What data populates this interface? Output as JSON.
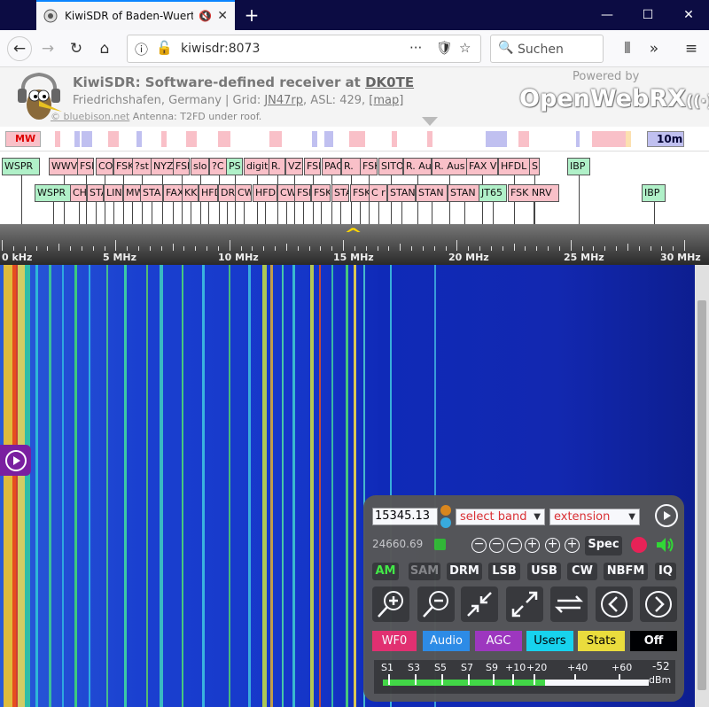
{
  "browser": {
    "tab_title": "KiwiSDR of Baden-Wuerttem",
    "url": "kiwisdr:8073",
    "search_placeholder": "Suchen"
  },
  "header": {
    "title_prefix": "KiwiSDR: Software-defined receiver at ",
    "callsign": "DK0TE",
    "location": "Friedrichshafen, Germany | Grid: ",
    "grid": "JN47rp",
    "asl": ", ASL: 429, ",
    "map": "[map]",
    "copyright": "© bluebison.net",
    "antenna": "Antenna: T2FD under roof.",
    "powered_by": "Powered by",
    "openwebrx": "OpenWebRX"
  },
  "bandbar": {
    "mw_label": "MW",
    "band_label": "10m"
  },
  "labels_row1": [
    {
      "text": "WSPR",
      "green": true
    },
    {
      "text": "WWV",
      "green": false
    },
    {
      "text": "FSK",
      "green": false
    },
    {
      "text": "CO",
      "green": false
    },
    {
      "text": "FSK",
      "green": false
    },
    {
      "text": "?st",
      "green": false
    },
    {
      "text": "NYZ",
      "green": false
    },
    {
      "text": "FSk",
      "green": false
    },
    {
      "text": "slo",
      "green": false
    },
    {
      "text": "?C",
      "green": false
    },
    {
      "text": "PS",
      "green": true
    },
    {
      "text": "digit",
      "green": false
    },
    {
      "text": "R.",
      "green": false
    },
    {
      "text": "VZ",
      "green": false
    },
    {
      "text": "FSK",
      "green": false
    },
    {
      "text": "PAC",
      "green": false
    },
    {
      "text": "R.",
      "green": false
    },
    {
      "text": "FSK",
      "green": false
    },
    {
      "text": "SITOR",
      "green": false
    },
    {
      "text": "R. Au",
      "green": false
    },
    {
      "text": "R. Aus",
      "green": false
    },
    {
      "text": "FAX V",
      "green": false
    },
    {
      "text": "HFDL",
      "green": false
    },
    {
      "text": "S",
      "green": false
    },
    {
      "text": "IBP",
      "green": true
    }
  ],
  "labels_row2": [
    {
      "text": "WSPR",
      "green": true
    },
    {
      "text": "CH",
      "green": false
    },
    {
      "text": "STA",
      "green": false
    },
    {
      "text": "LIN",
      "green": false
    },
    {
      "text": "MW",
      "green": false
    },
    {
      "text": "STA",
      "green": false
    },
    {
      "text": "FAX",
      "green": false
    },
    {
      "text": "KK",
      "green": false
    },
    {
      "text": "HFD",
      "green": false
    },
    {
      "text": "DR",
      "green": false
    },
    {
      "text": "CW",
      "green": false
    },
    {
      "text": "HFD",
      "green": false
    },
    {
      "text": "CW",
      "green": false
    },
    {
      "text": "FSK",
      "green": false
    },
    {
      "text": "FSK",
      "green": false
    },
    {
      "text": "STA",
      "green": false
    },
    {
      "text": "FSK",
      "green": false
    },
    {
      "text": "C r",
      "green": false
    },
    {
      "text": "STAN",
      "green": false
    },
    {
      "text": "STAN",
      "green": false
    },
    {
      "text": "STAN",
      "green": false
    },
    {
      "text": "JT65",
      "green": true
    },
    {
      "text": "FSK NRV",
      "green": false
    },
    {
      "text": "IBP",
      "green": true
    }
  ],
  "scale": {
    "labels": [
      "0 kHz",
      "5 MHz",
      "10 MHz",
      "15 MHz",
      "20 MHz",
      "25 MHz",
      "30 MHz"
    ]
  },
  "panel": {
    "frequency": "15345.13",
    "select_band": "select band",
    "extension": "extension",
    "secondary_freq": "24660.69",
    "spec": "Spec",
    "modes": [
      "AM",
      "SAM",
      "DRM",
      "LSB",
      "USB",
      "CW",
      "NBFM",
      "IQ"
    ],
    "buttons": [
      "WF0",
      "Audio",
      "AGC",
      "Users",
      "Stats",
      "Off"
    ],
    "smeter_labels": [
      "S1",
      "S3",
      "S5",
      "S7",
      "S9",
      "+10",
      "+20",
      "+40",
      "+60"
    ],
    "dbm_value": "-52",
    "dbm_unit": "dBm",
    "smeter_level_pct": 61,
    "colors": {
      "wf0": "#e8316f",
      "audio": "#2e8fe8",
      "agc": "#a238c0",
      "users": "#18d8f0",
      "stats": "#f2e23a",
      "off": "#000000",
      "am": "#44ee44"
    }
  }
}
